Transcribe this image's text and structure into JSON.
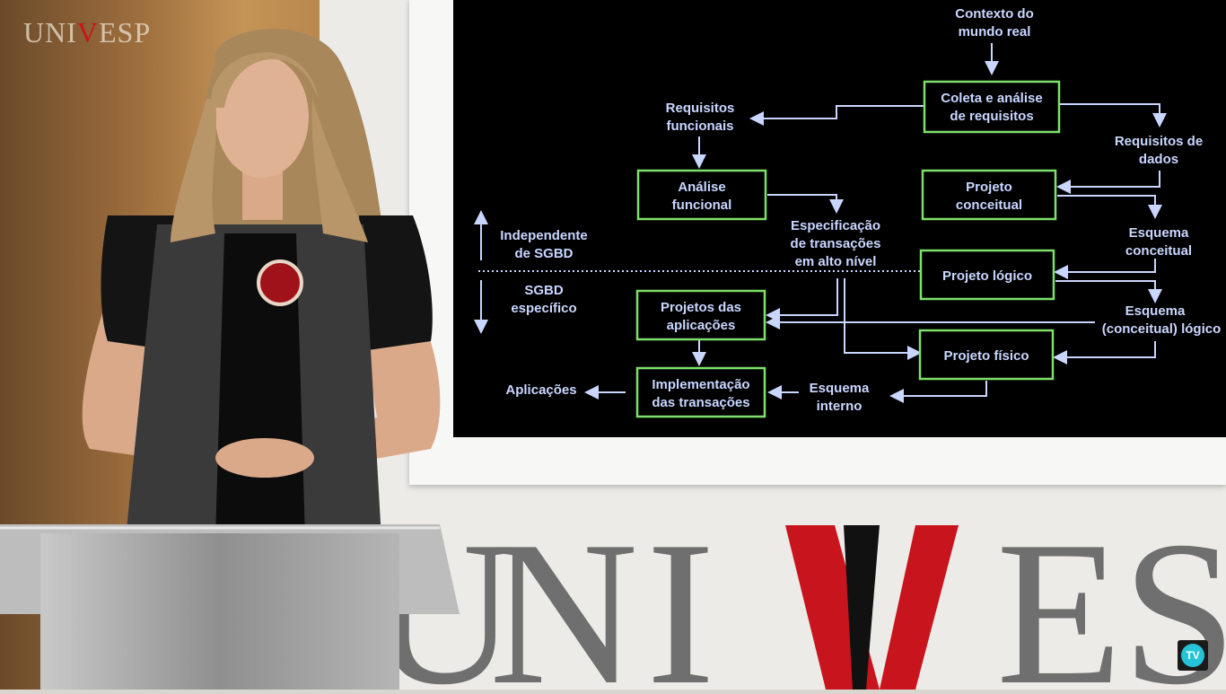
{
  "branding": {
    "small_logo": {
      "prefix": "UNI",
      "v": "V",
      "suffix": "ESP"
    },
    "big_logo_letters": [
      "U",
      "N",
      "I",
      "V",
      "E",
      "S"
    ],
    "tv_badge": "TV"
  },
  "colors": {
    "screen_bg": "#000000",
    "box_border": "#7ee06a",
    "text": "#c9d6ff",
    "arrow": "#c9d6ff",
    "logo_red": "#c8141c"
  },
  "diagram": {
    "contexto": [
      "Contexto do",
      "mundo real"
    ],
    "coleta": [
      "Coleta e análise",
      "de requisitos"
    ],
    "req_funcionais": [
      "Requisitos",
      "funcionais"
    ],
    "req_dados": [
      "Requisitos de",
      "dados"
    ],
    "analise_funcional": [
      "Análise",
      "funcional"
    ],
    "projeto_conceitual": [
      "Projeto",
      "conceitual"
    ],
    "especificacao": [
      "Especificação",
      "de transações",
      "em alto nível"
    ],
    "esquema_conceitual": [
      "Esquema",
      "conceitual"
    ],
    "independente": [
      "Independente",
      "de SGBD"
    ],
    "sgbd_especifico": [
      "SGBD",
      "específico"
    ],
    "projeto_logico": "Projeto lógico",
    "projetos_aplicacoes": [
      "Projetos das",
      "aplicações"
    ],
    "esquema_logico": [
      "Esquema",
      "(conceitual) lógico"
    ],
    "projeto_fisico": "Projeto físico",
    "aplicacoes": "Aplicações",
    "implementacao": [
      "Implementação",
      "das transações"
    ],
    "esquema_interno": [
      "Esquema",
      "interno"
    ]
  }
}
